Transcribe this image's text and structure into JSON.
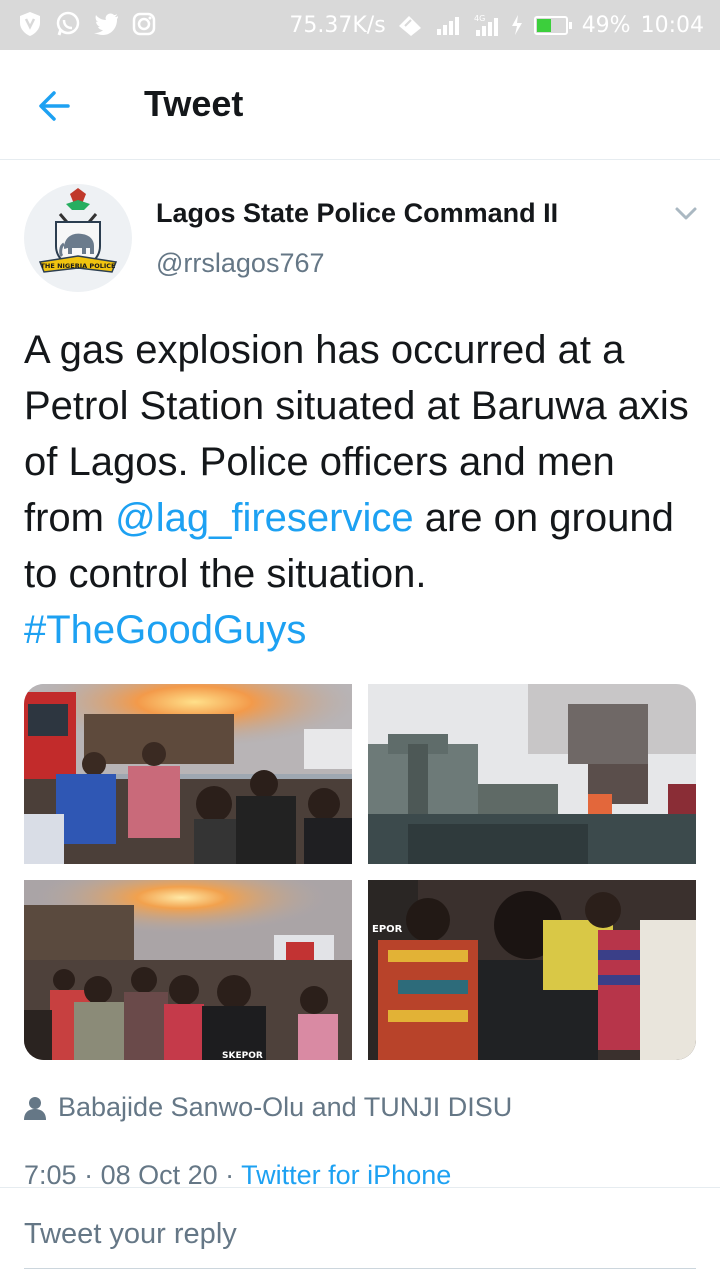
{
  "status_bar": {
    "speed": "75.37K/s",
    "battery": "49%",
    "time": "10:04",
    "icons": [
      "vpn-shield-icon",
      "whatsapp-icon",
      "twitter-bird-icon",
      "instagram-icon",
      "data-saver-icon",
      "signal-icon",
      "4g-signal-icon",
      "charging-icon",
      "battery-icon"
    ],
    "battery_level": 0.49
  },
  "header": {
    "title": "Tweet",
    "back_icon": "arrow-left-icon"
  },
  "author": {
    "name": "Lagos State Police Command II",
    "handle": "@rrslagos767",
    "avatar_text": "THE NIGERIA POLICE"
  },
  "tweet": {
    "text_before": "A gas explosion has occurred at a Petrol Station situated at Baruwa axis of Lagos. Police officers and men from ",
    "mention": "@lag_fireservice",
    "text_after": " are on ground to control the situation. ",
    "hashtag": "#TheGoodGuys"
  },
  "media": {
    "photo4_overlay_text": "EPOR",
    "photo3_shirt_text": "SKEPOR"
  },
  "tagged": {
    "text": "Babajide Sanwo-Olu and TUNJI DISU"
  },
  "meta": {
    "time": "7:05",
    "date": "08 Oct 20",
    "separator": " · ",
    "source": "Twitter for iPhone"
  },
  "reply": {
    "placeholder": "Tweet your reply"
  },
  "colors": {
    "accent": "#1da1f2",
    "secondary_text": "#657786",
    "status_bar_bg": "#d9d9d9"
  }
}
